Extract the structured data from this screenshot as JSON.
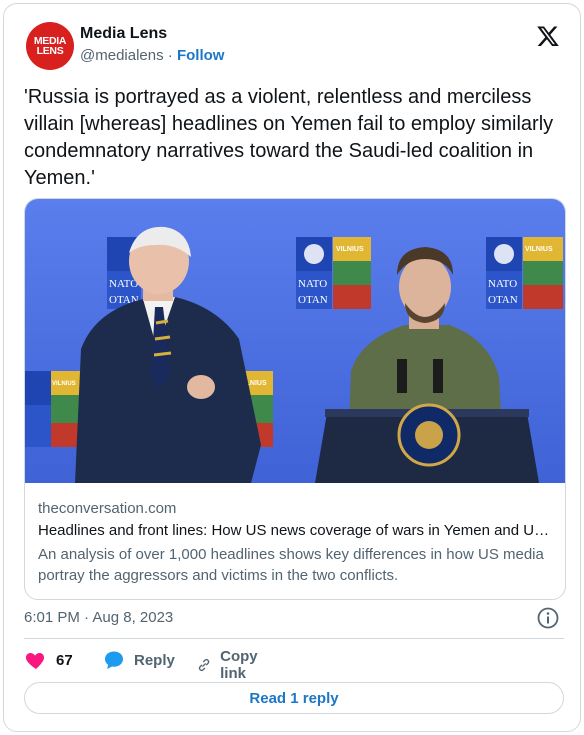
{
  "author": {
    "name": "Media Lens",
    "handle": "@medialens",
    "separator": "·",
    "follow_label": "Follow",
    "avatar_line1": "MEDIA",
    "avatar_line2": "LENS"
  },
  "tweet": {
    "text": "'Russia  is portrayed as a violent, relentless and merciless villain [whereas] headlines on Yemen fail to employ similarly condemnatory narratives toward the Saudi-led coalition in Yemen.'",
    "timestamp": "6:01 PM · Aug 8, 2023"
  },
  "link_card": {
    "domain": "theconversation.com",
    "title": "Headlines and front lines: How US news coverage of wars in Yemen and Ukraine differ",
    "description": "An analysis of over 1,000 headlines shows key differences in how US media portray the aggressors and victims in the two conflicts.",
    "image_signs": {
      "line1": "NATO",
      "line2": "OTAN",
      "badge": "VILNIUS"
    }
  },
  "actions": {
    "like_count": "67",
    "reply_label": "Reply",
    "copy_label": "Copy link"
  },
  "read_reply_label": "Read 1 reply",
  "colors": {
    "avatar_red": "#d8201f",
    "link_blue": "#1d77c6",
    "heart_pink": "#f91880",
    "reply_blue": "#1d9bf0",
    "muted": "#536471",
    "photo_backdrop": "#4f74e6"
  },
  "icons": [
    "x-logo-icon",
    "info-icon",
    "heart-icon",
    "reply-bubble-icon",
    "link-icon"
  ]
}
